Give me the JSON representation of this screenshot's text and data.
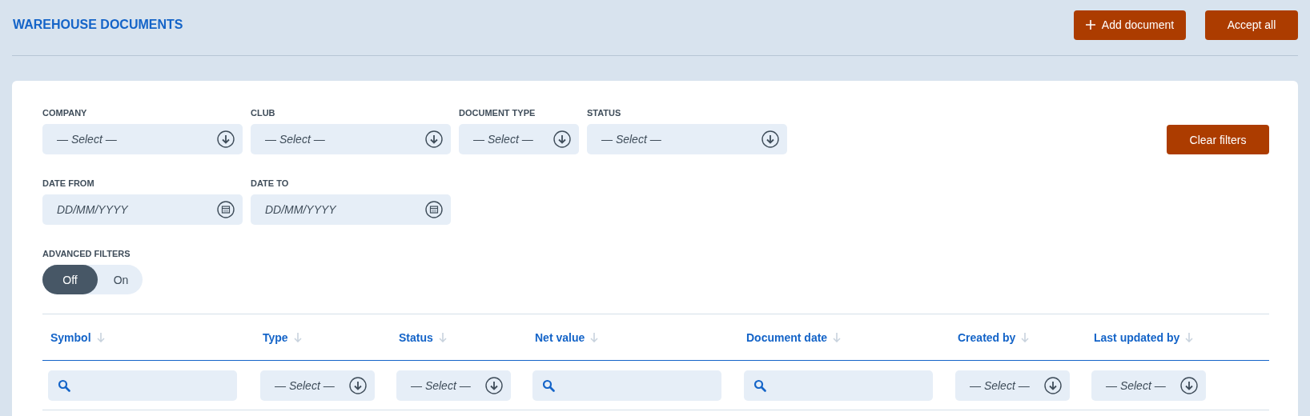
{
  "page_title": "WAREHOUSE DOCUMENTS",
  "header_buttons": [
    {
      "label": "Add document",
      "kind": "add"
    },
    {
      "label": "Accept all",
      "kind": "plain"
    }
  ],
  "filters": [
    {
      "label": "COMPANY",
      "placeholder": "— Select —",
      "kind": "select"
    },
    {
      "label": "CLUB",
      "placeholder": "— Select —",
      "kind": "select"
    },
    {
      "label": "DOCUMENT TYPE",
      "placeholder": "— Select —",
      "kind": "select"
    },
    {
      "label": "STATUS",
      "placeholder": "— Select —",
      "kind": "select"
    }
  ],
  "clear_button": "Clear filters",
  "date_filters": [
    {
      "label": "DATE FROM",
      "placeholder": "DD/MM/YYYY",
      "kind": "date"
    },
    {
      "label": "DATE TO",
      "placeholder": "DD/MM/YYYY",
      "kind": "date"
    }
  ],
  "advanced_filters": {
    "label": "ADVANCED FILTERS",
    "options": [
      {
        "label": "Off",
        "selected": true
      },
      {
        "label": "On",
        "selected": false
      }
    ]
  },
  "table": {
    "columns": [
      {
        "heading": "Symbol",
        "filter": {
          "kind": "search"
        }
      },
      {
        "heading": "Type",
        "filter": {
          "kind": "select",
          "placeholder": "— Select —"
        }
      },
      {
        "heading": "Status",
        "filter": {
          "kind": "select",
          "placeholder": "— Select —"
        }
      },
      {
        "heading": "Net value",
        "filter": {
          "kind": "search"
        }
      },
      {
        "heading": "Document date",
        "filter": {
          "kind": "search"
        }
      },
      {
        "heading": "Created by",
        "filter": {
          "kind": "select",
          "placeholder": "— Select —"
        }
      },
      {
        "heading": "Last updated by",
        "filter": {
          "kind": "select",
          "placeholder": "— Select —"
        }
      }
    ]
  }
}
